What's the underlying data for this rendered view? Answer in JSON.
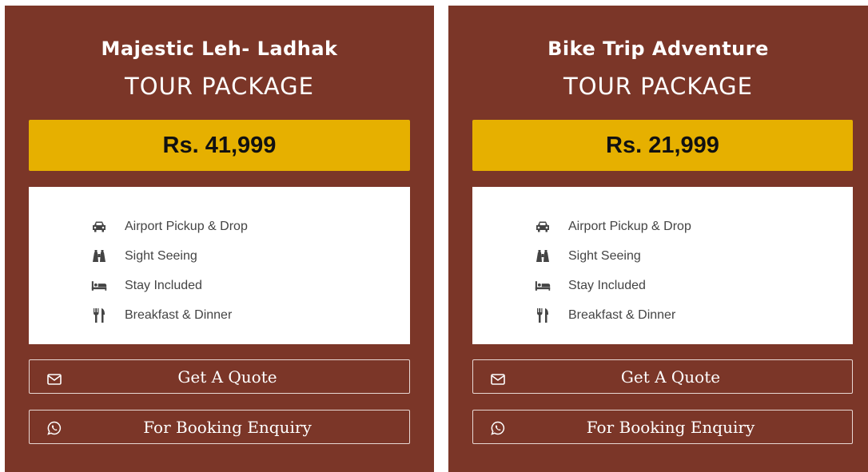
{
  "cards": [
    {
      "title": "Majestic Leh- Ladhak",
      "subtitle": "TOUR PACKAGE",
      "price": "Rs. 41,999",
      "features": [
        {
          "icon": "car-icon",
          "label": "Airport Pickup & Drop"
        },
        {
          "icon": "binoculars-icon",
          "label": "Sight Seeing"
        },
        {
          "icon": "bed-icon",
          "label": "Stay Included"
        },
        {
          "icon": "utensils-icon",
          "label": "Breakfast & Dinner"
        }
      ],
      "quote_label": "Get A Quote",
      "booking_label": "For Booking Enquiry"
    },
    {
      "title": "Bike Trip Adventure",
      "subtitle": "TOUR PACKAGE",
      "price": "Rs. 21,999",
      "features": [
        {
          "icon": "car-icon",
          "label": "Airport Pickup & Drop"
        },
        {
          "icon": "binoculars-icon",
          "label": "Sight Seeing"
        },
        {
          "icon": "bed-icon",
          "label": "Stay Included"
        },
        {
          "icon": "utensils-icon",
          "label": "Breakfast & Dinner"
        }
      ],
      "quote_label": "Get A Quote",
      "booking_label": "For Booking Enquiry"
    }
  ],
  "colors": {
    "card_bg": "#7b3628",
    "price_bg": "#e6b000",
    "text_light": "#ffffff",
    "feature_text": "#444444"
  }
}
